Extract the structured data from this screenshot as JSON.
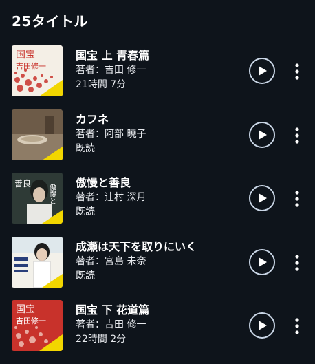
{
  "header": {
    "title": "25タイトル"
  },
  "colors": {
    "background": "#0e141b",
    "text": "#ffffff",
    "play_ring": "#c9d6e6"
  },
  "books": [
    {
      "title": "国宝 上 青春篇",
      "author": "著者：吉田 修一",
      "status": "21時間 7分",
      "cover_icon": "kokuho-jo-cover"
    },
    {
      "title": "カフネ",
      "author": "著者：阿部 暁子",
      "status": "既読",
      "cover_icon": "kafune-cover"
    },
    {
      "title": "傲慢と善良",
      "author": "著者：辻村 深月",
      "status": "既読",
      "cover_icon": "goman-to-zenryo-cover"
    },
    {
      "title": "成瀬は天下を取りにいく",
      "author": "著者：宮島 未奈",
      "status": "既読",
      "cover_icon": "naruse-cover"
    },
    {
      "title": "国宝 下 花道篇",
      "author": "著者：吉田 修一",
      "status": "22時間 2分",
      "cover_icon": "kokuho-ge-cover"
    }
  ],
  "cover_text": {
    "kokuho": "国宝",
    "kokuho_author": "吉田修一",
    "goman": "傲慢と",
    "zenryo": "善良"
  }
}
